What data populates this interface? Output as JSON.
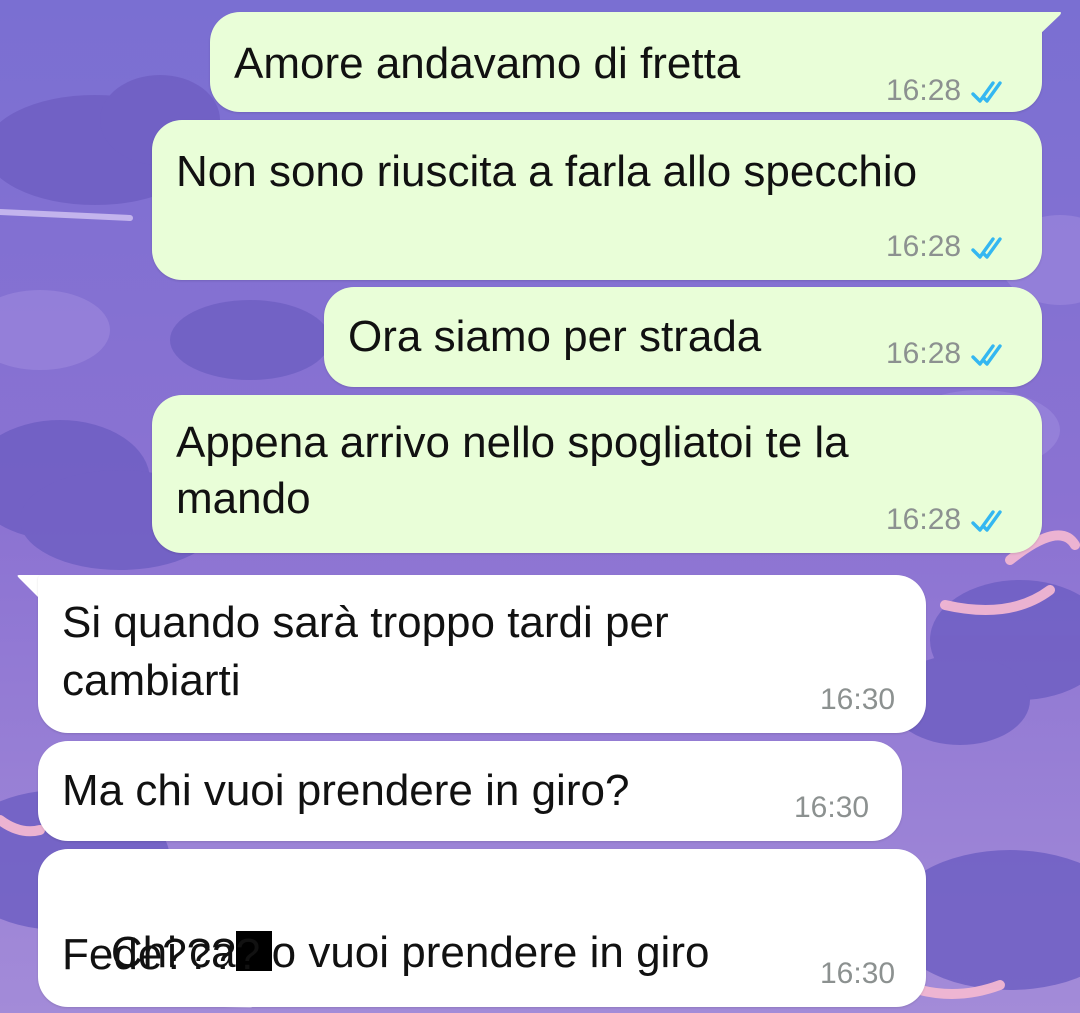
{
  "chat": {
    "colors": {
      "outgoing_bubble": "#e9fed8",
      "incoming_bubble": "#ffffff",
      "read_ticks": "#34b7f1",
      "timestamp": "#8c9190",
      "wallpaper": "#8a73d2"
    },
    "messages": [
      {
        "direction": "outgoing",
        "text": "Amore andavamo di fretta",
        "time": "16:28",
        "status": "read"
      },
      {
        "direction": "outgoing",
        "text": "Non sono riuscita a farla allo specchio",
        "time": "16:28",
        "status": "read"
      },
      {
        "direction": "outgoing",
        "text": "Ora siamo per strada",
        "time": "16:28",
        "status": "read"
      },
      {
        "direction": "outgoing",
        "text_line1": "Appena arrivo nello spogliatoi te la",
        "text_line2": "mando",
        "time": "16:28",
        "status": "read"
      },
      {
        "direction": "incoming",
        "text_line1": "Si quando sarà troppo tardi per",
        "text_line2": "cambiarti",
        "time": "16:30"
      },
      {
        "direction": "incoming",
        "text": "Ma chi vuoi prendere in giro?",
        "time": "16:30"
      },
      {
        "direction": "incoming",
        "text_part1": "Chi ca",
        "text_redacted": "[censored]",
        "text_part2": "o vuoi prendere in giro",
        "text_line2": "Fede????",
        "time": "16:30"
      }
    ]
  }
}
